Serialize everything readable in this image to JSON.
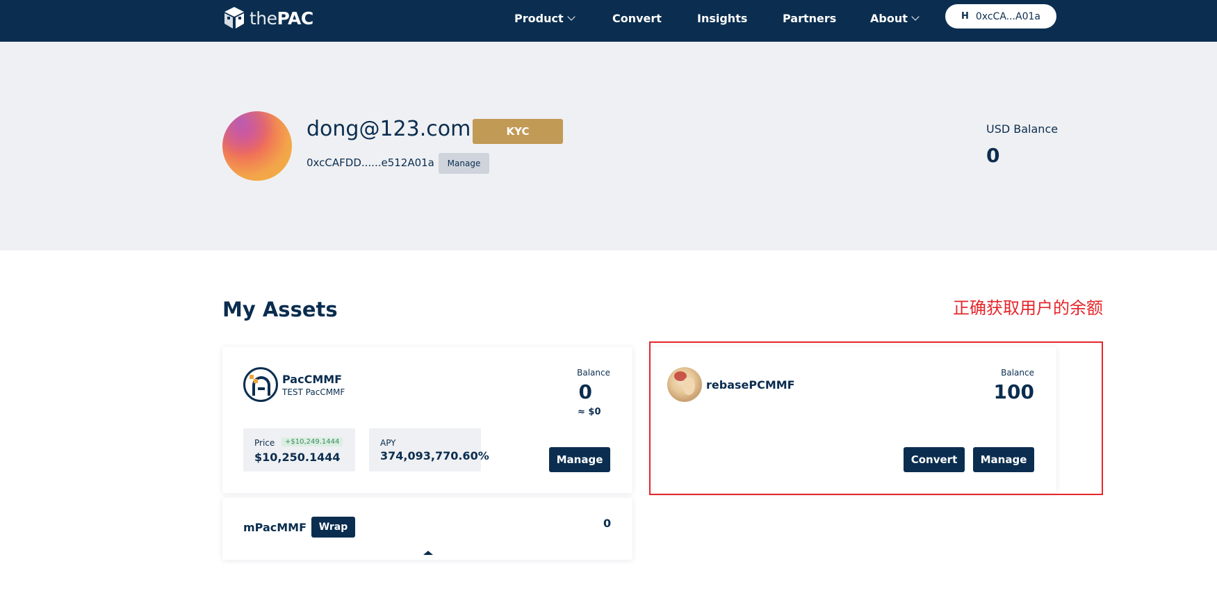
{
  "header": {
    "logo": {
      "prefix": "the",
      "name": "PAC"
    },
    "nav": [
      {
        "label": "Product",
        "has_dropdown": true
      },
      {
        "label": "Convert",
        "has_dropdown": false
      },
      {
        "label": "Insights",
        "has_dropdown": false
      },
      {
        "label": "Partners",
        "has_dropdown": false
      },
      {
        "label": "About",
        "has_dropdown": true
      }
    ],
    "wallet": {
      "icon": "wallet-h-icon",
      "glyph": "H",
      "address": "0xcCA...A01a"
    }
  },
  "profile": {
    "email": "dong@123.com",
    "kyc_label": "KYC",
    "address": "0xcCAFDD......e512A01a",
    "manage_label": "Manage",
    "usd_balance_label": "USD Balance",
    "usd_balance_value": "0",
    "colors": {
      "kyc": "#c19a55",
      "band": "#eff0f3"
    }
  },
  "assets": {
    "title": "My Assets",
    "annotation": "正确获取用户的余额",
    "cards": [
      {
        "name": "PacCMMF",
        "subtitle": "TEST PacCMMF",
        "balance_label": "Balance",
        "balance": "0",
        "balance_usd": "≈ $0",
        "price_label": "Price",
        "price_change": "+$10,249.1444",
        "price": "$10,250.1444",
        "apy_label": "APY",
        "apy": "374,093,770.60%",
        "manage_label": "Manage"
      },
      {
        "name": "rebasePCMMF",
        "balance_label": "Balance",
        "balance": "100",
        "convert_label": "Convert",
        "manage_label": "Manage"
      }
    ],
    "sub_card": {
      "name": "mPacMMF",
      "wrap_label": "Wrap",
      "value": "0"
    }
  },
  "colors": {
    "navy": "#0b2e50",
    "annotation_red": "#e5262a",
    "change_green": "#3a8a5e"
  }
}
